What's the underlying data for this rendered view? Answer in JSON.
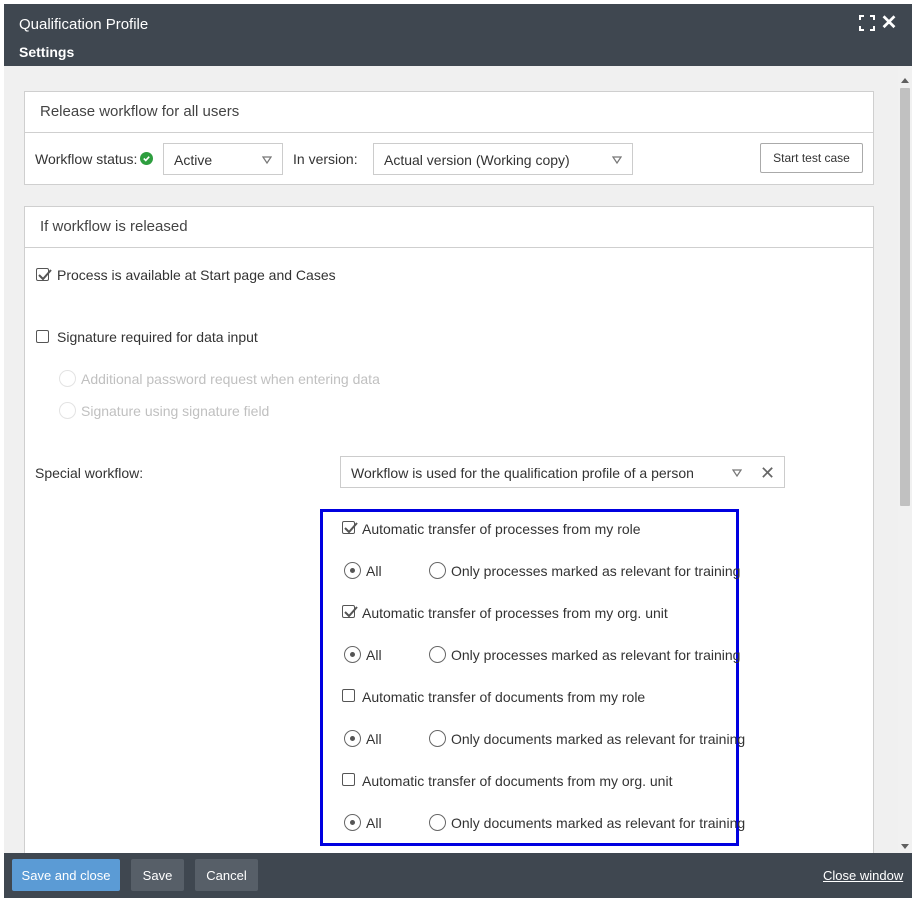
{
  "window": {
    "title": "Qualification Profile",
    "subtitle": "Settings"
  },
  "release_panel": {
    "title": "Release workflow for all users",
    "workflow_status_label": "Workflow status:",
    "status_value": "Active",
    "in_version_label": "In version:",
    "version_value": "Actual version (Working copy)",
    "start_test_case": "Start test case"
  },
  "released_panel": {
    "title": "If workflow is released",
    "process_available": {
      "label": "Process is available at Start page and Cases",
      "checked": true
    },
    "signature_required": {
      "label": "Signature required for data input",
      "checked": false
    },
    "additional_password": "Additional password request when entering data",
    "signature_field": "Signature using signature field",
    "special_workflow_label": "Special workflow:",
    "special_workflow_value": "Workflow is used for the qualification profile of a person",
    "transfers": [
      {
        "label": "Automatic transfer of processes from my role",
        "checked": true,
        "all_label": "All",
        "only_label": "Only processes marked as relevant for training",
        "selected": "all"
      },
      {
        "label": "Automatic transfer of processes from my org. unit",
        "checked": true,
        "all_label": "All",
        "only_label": "Only processes marked as relevant for training",
        "selected": "all"
      },
      {
        "label": "Automatic transfer of documents from my role",
        "checked": false,
        "all_label": "All",
        "only_label": "Only documents marked as relevant for training",
        "selected": "all"
      },
      {
        "label": "Automatic transfer of documents from my org. unit",
        "checked": false,
        "all_label": "All",
        "only_label": "Only documents marked as relevant for training",
        "selected": "all"
      }
    ]
  },
  "footer": {
    "save_and_close": "Save and close",
    "save": "Save",
    "cancel": "Cancel",
    "close_window": "Close window"
  },
  "colors": {
    "header_bg": "#3f4750",
    "primary_button": "#5b9bd5",
    "status_ok": "#2e9e3f",
    "highlight": "#0000e0"
  }
}
